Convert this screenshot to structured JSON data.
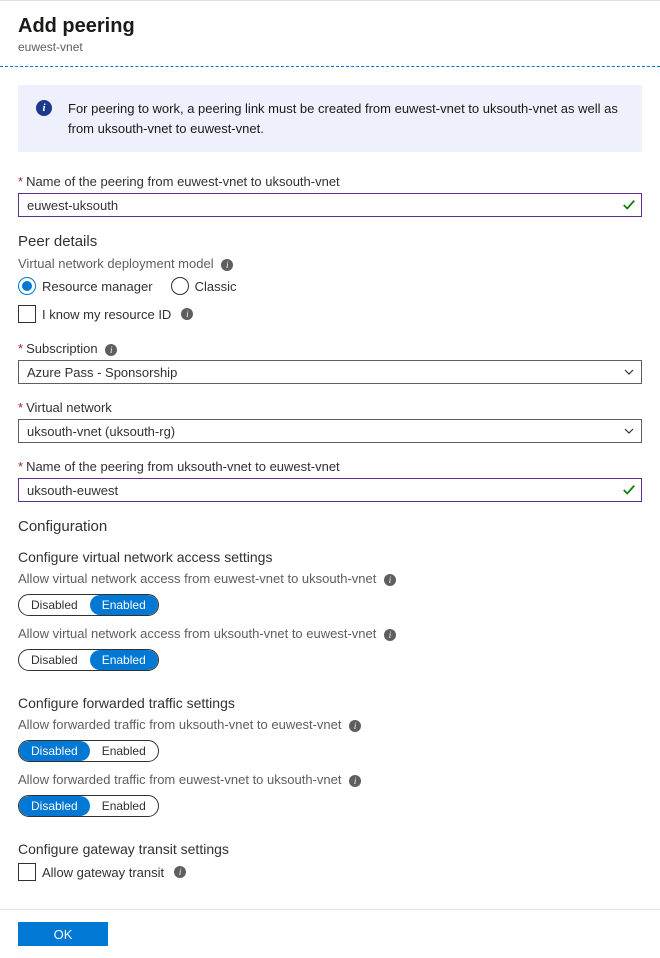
{
  "header": {
    "title": "Add peering",
    "subtitle": "euwest-vnet"
  },
  "info": {
    "text": "For peering to work, a peering link must be created from euwest-vnet to uksouth-vnet as well as from uksouth-vnet to euwest-vnet."
  },
  "name1": {
    "label": "Name of the peering from euwest-vnet to uksouth-vnet",
    "value": "euwest-uksouth"
  },
  "peer_details": {
    "heading": "Peer details",
    "deployment_label": "Virtual network deployment model",
    "option_rm": "Resource manager",
    "option_classic": "Classic",
    "know_resource_id": "I know my resource ID"
  },
  "subscription": {
    "label": "Subscription",
    "value": "Azure Pass - Sponsorship"
  },
  "vnet": {
    "label": "Virtual network",
    "value": "uksouth-vnet (uksouth-rg)"
  },
  "name2": {
    "label": "Name of the peering from uksouth-vnet to euwest-vnet",
    "value": "uksouth-euwest"
  },
  "configuration": {
    "heading": "Configuration",
    "access_heading": "Configure virtual network access settings",
    "access1_label": "Allow virtual network access from euwest-vnet to uksouth-vnet",
    "access2_label": "Allow virtual network access from uksouth-vnet to euwest-vnet",
    "forwarded_heading": "Configure forwarded traffic settings",
    "forwarded1_label": "Allow forwarded traffic from uksouth-vnet to euwest-vnet",
    "forwarded2_label": "Allow forwarded traffic from euwest-vnet to uksouth-vnet",
    "gateway_heading": "Configure gateway transit settings",
    "allow_gateway": "Allow gateway transit",
    "disabled": "Disabled",
    "enabled": "Enabled"
  },
  "footer": {
    "ok": "OK"
  }
}
